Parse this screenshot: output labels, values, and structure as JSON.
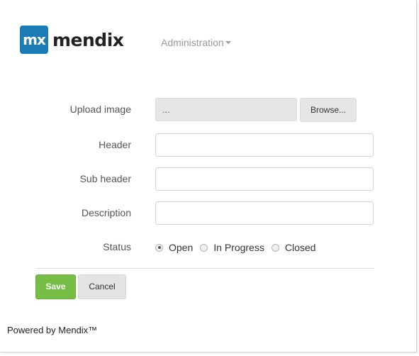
{
  "header": {
    "logo_badge": "mx",
    "logo_text": "mendix",
    "nav_admin": "Administration"
  },
  "form": {
    "upload_label": "Upload image",
    "upload_value": "...",
    "browse_label": "Browse...",
    "header_label": "Header",
    "header_value": "",
    "subheader_label": "Sub header",
    "subheader_value": "",
    "description_label": "Description",
    "description_value": "",
    "status_label": "Status",
    "status_options": [
      "Open",
      "In Progress",
      "Closed"
    ],
    "status_selected": "Open"
  },
  "actions": {
    "save_label": "Save",
    "cancel_label": "Cancel"
  },
  "footer": {
    "text": "Powered by Mendix™"
  },
  "colors": {
    "brand_blue": "#1b7bb5",
    "save_green": "#76bd46"
  }
}
